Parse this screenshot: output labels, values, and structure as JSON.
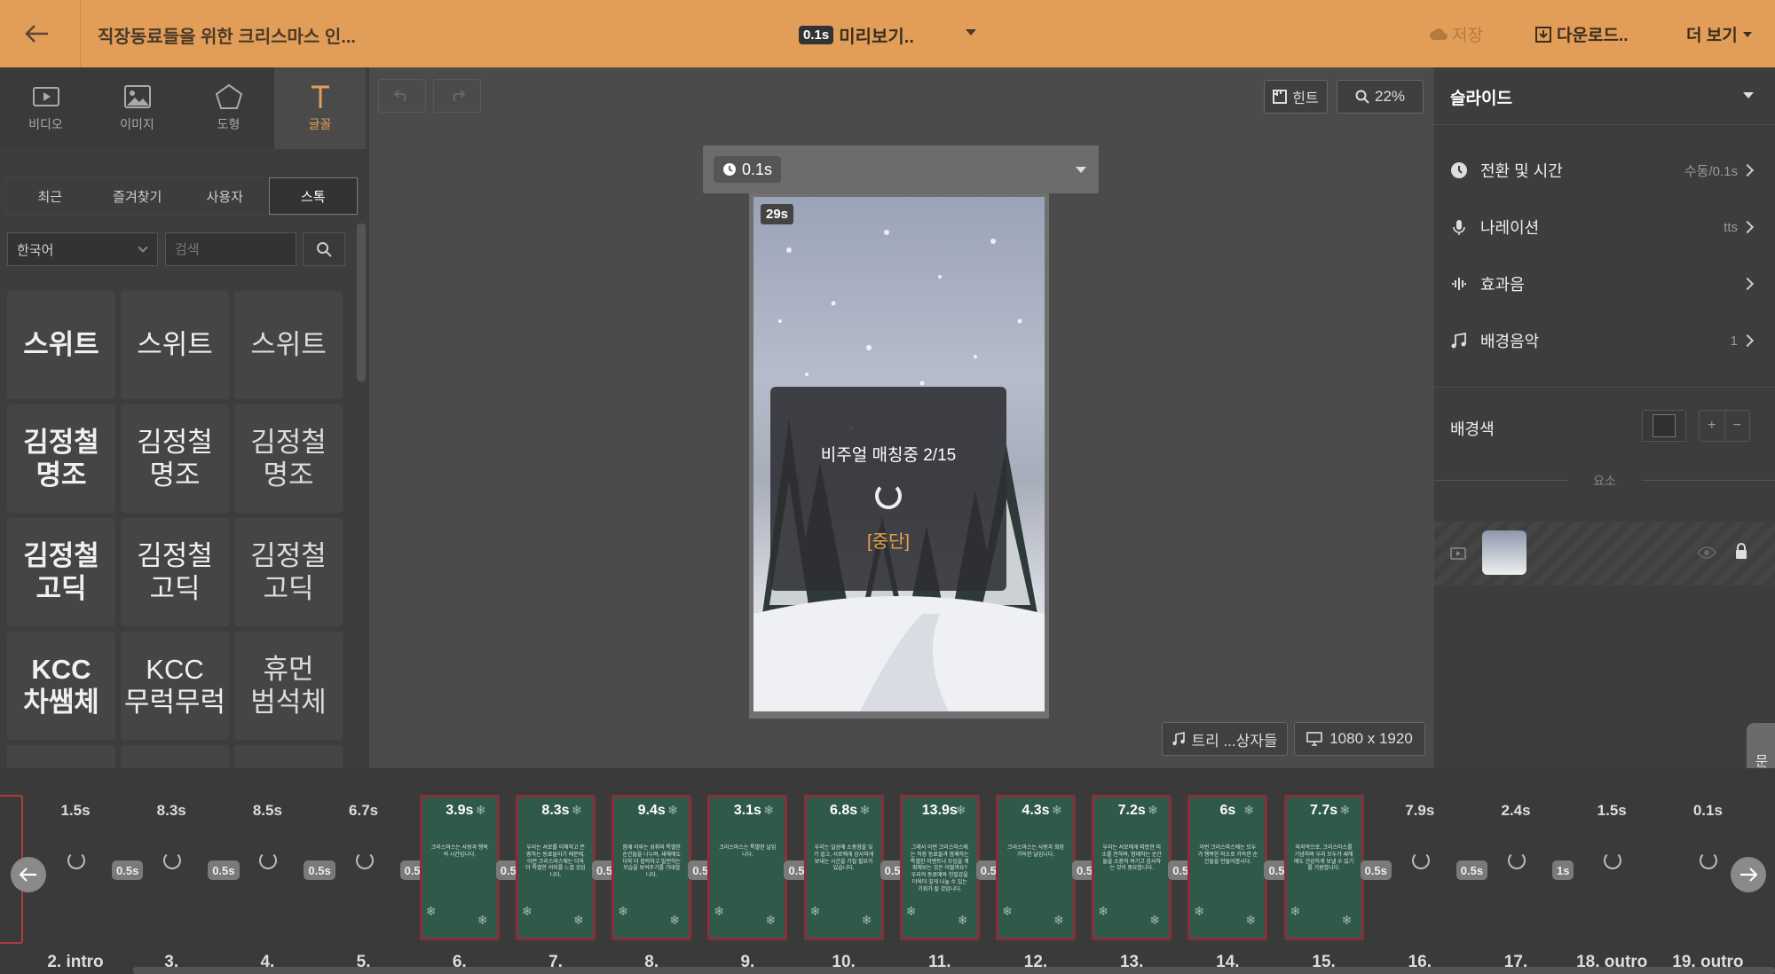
{
  "header": {
    "project_title": "직장동료들을 위한 크리스마스 인...",
    "preview_badge": "0.1s",
    "preview_label": "미리보기..",
    "save_label": "저장",
    "download_label": "다운로드..",
    "more_label": "더 보기"
  },
  "left_panel": {
    "tools": [
      {
        "label": "비디오",
        "icon": "video-icon"
      },
      {
        "label": "이미지",
        "icon": "image-icon"
      },
      {
        "label": "도형",
        "icon": "pentagon-icon"
      },
      {
        "label": "글꼴",
        "icon": "text-icon"
      }
    ],
    "active_tool": "글꼴",
    "subtabs": [
      "최근",
      "즐겨찾기",
      "사용자",
      "스톡"
    ],
    "active_subtab": "스톡",
    "language": "한국어",
    "search_placeholder": "검색",
    "fonts": [
      "스위트",
      "스위트",
      "스위트",
      "김정철\n명조",
      "김정철\n명조",
      "김정철\n명조",
      "김정철\n고딕",
      "김정철\n고딕",
      "김정철\n고딕",
      "KCC\n차쌤체",
      "KCC\n무럭무럭",
      "휴먼\n범석체"
    ]
  },
  "canvas": {
    "hint_label": "힌트",
    "zoom": "22%",
    "duration_badge": "0.1s",
    "section_time": "29s",
    "modal": {
      "title": "비주얼 매칭중 2/15",
      "stop_label": "[중단]"
    },
    "music_label": "트리 ...상자들",
    "resolution": "1080 x 1920"
  },
  "right_panel": {
    "header": "슬라이드",
    "rows": [
      {
        "label": "전환 및 시간",
        "value": "수동/0.1s",
        "icon": "clock-icon"
      },
      {
        "label": "나레이션",
        "value": "tts",
        "icon": "microphone-icon"
      },
      {
        "label": "효과음",
        "value": "",
        "icon": "sound-wave-icon"
      },
      {
        "label": "배경음악",
        "value": "1",
        "icon": "music-note-icon"
      }
    ],
    "bg_color_label": "배경색",
    "bg_color": "#303030",
    "plus": "+",
    "minus": "−",
    "elements_label": "요소"
  },
  "side_tab": "문의",
  "timeline": {
    "clips": [
      {
        "num": "2. intro",
        "dur": "1.5s",
        "trans": "0.5s",
        "thumb": false,
        "text": ""
      },
      {
        "num": "3.",
        "dur": "8.3s",
        "trans": "0.5s",
        "thumb": false,
        "text": ""
      },
      {
        "num": "4.",
        "dur": "8.5s",
        "trans": "0.5s",
        "thumb": false,
        "text": ""
      },
      {
        "num": "5.",
        "dur": "6.7s",
        "trans": "0.5s",
        "thumb": false,
        "text": ""
      },
      {
        "num": "6.",
        "dur": "3.9s",
        "trans": "0.5s",
        "thumb": true,
        "text": "크리스마스는 사랑과 행복의 시간입니다."
      },
      {
        "num": "7.",
        "dur": "8.3s",
        "trans": "0.5s",
        "thumb": true,
        "text": "우리는 서로를 이해하고 존중하는 동료들이기 때문에, 이번 크리스마스에는 더욱더 특별한 의미를 느낄 것입니다."
      },
      {
        "num": "8.",
        "dur": "9.4s",
        "trans": "0.5s",
        "thumb": true,
        "text": "함께 이루는 성취와 특별한 순간들을 나누며, 새해에도 더욱 더 협력하고 발전하는 모습을 보여주기를 기대합니다."
      },
      {
        "num": "9.",
        "dur": "3.1s",
        "trans": "0.5s",
        "thumb": true,
        "text": "크리스마스는 특별한 날입니다."
      },
      {
        "num": "10.",
        "dur": "6.8s",
        "trans": "0.5s",
        "thumb": true,
        "text": "우리는 일상에 소중함을 잊기 쉽고, 서로에게 감사하게 보내는 시간을 가질 필요가 있습니다."
      },
      {
        "num": "11.",
        "dur": "13.9s",
        "trans": "0.5s",
        "thumb": true,
        "text": "그래서 이번 크리스마스에는 직장 동료들과 함께하는 특별한 이벤트나 모임을 계획해보는 것은 어떨까요? 우리의 동료애와 친밀감을 더욱더 깊게 나눌 수 있는 기회가 될 것입니다."
      },
      {
        "num": "12.",
        "dur": "4.3s",
        "trans": "0.5s",
        "thumb": true,
        "text": "크리스마스는 사랑과 희망 가득한 날입니다."
      },
      {
        "num": "13.",
        "dur": "7.2s",
        "trans": "0.5s",
        "thumb": true,
        "text": "우리는 서로에게 따뜻한 미소를 전하며, 함께하는 순간들을 소중히 여기고 감사하는 것이 중요합니다."
      },
      {
        "num": "14.",
        "dur": "6s",
        "trans": "0.5s",
        "thumb": true,
        "text": "이번 크리스마스에는 모두가 행복한 미소로 가득한 순간들을 만들어봅시다."
      },
      {
        "num": "15.",
        "dur": "7.7s",
        "trans": "0.5s",
        "thumb": true,
        "text": "마지막으로, 크리스마스를 기념하며 우리 모두가 새해에도 건강하게 보낼 수 있기를 기원합니다."
      },
      {
        "num": "16.",
        "dur": "7.9s",
        "trans": "0.5s",
        "thumb": false,
        "text": ""
      },
      {
        "num": "17.",
        "dur": "2.4s",
        "trans": "1s",
        "thumb": false,
        "text": ""
      },
      {
        "num": "18. outro",
        "dur": "1.5s",
        "trans": "",
        "thumb": false,
        "text": ""
      },
      {
        "num": "19. outro",
        "dur": "0.1s",
        "trans": "",
        "thumb": false,
        "text": ""
      }
    ]
  }
}
